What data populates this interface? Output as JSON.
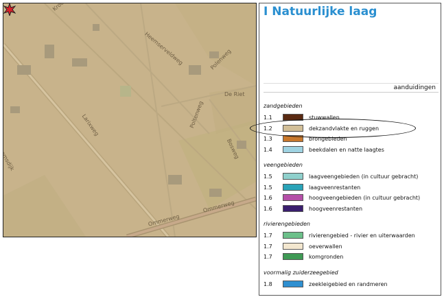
{
  "map": {
    "streets": [
      "Kroondijk",
      "Heemserveldweg",
      "Polenweg",
      "De Riet",
      "Poltenweg",
      "Larixweg",
      "Bosweg",
      "Ommerweg",
      "Ommerweg",
      "emsdijk"
    ],
    "marker_icon": "red-star-marker"
  },
  "legend": {
    "title": "I Natuurlijke laag",
    "header": "aanduidingen",
    "sections": [
      {
        "title": "zandgebieden",
        "rows": [
          {
            "num": "1.1",
            "label": "stuwwallen",
            "color": "#5a2a12"
          },
          {
            "num": "1.2",
            "label": "dekzandvlakte en ruggen",
            "color": "#d2bf98"
          },
          {
            "num": "1.3",
            "label": "brongebieden",
            "color": "#c9782c"
          },
          {
            "num": "1.4",
            "label": "beekdalen en natte laagtes",
            "color": "#9fd3e2"
          }
        ]
      },
      {
        "title": "veengebieden",
        "rows": [
          {
            "num": "1.5",
            "label": "laagveengebieden (in cultuur gebracht)",
            "color": "#8fd0cc"
          },
          {
            "num": "1.5",
            "label": "laagveenrestanten",
            "color": "#2aa3b8"
          },
          {
            "num": "1.6",
            "label": "hoogveengebieden (in cultuur gebracht)",
            "color": "#b54fa8"
          },
          {
            "num": "1.6",
            "label": "hoogveenrestanten",
            "color": "#3a1e6e"
          }
        ]
      },
      {
        "title": "rivierengebieden",
        "rows": [
          {
            "num": "1.7",
            "label": "rivierengebied - rivier en uiterwaarden",
            "color": "#6cc08a"
          },
          {
            "num": "1.7",
            "label": "oeverwallen",
            "color": "#f3e7cf"
          },
          {
            "num": "1.7",
            "label": "komgronden",
            "color": "#3f9a55"
          }
        ]
      },
      {
        "title": "voormalig zuiderzeegebied",
        "rows": [
          {
            "num": "1.8",
            "label": "zeekleigebied en randmeren",
            "color": "#2f8fd0"
          }
        ]
      }
    ]
  }
}
